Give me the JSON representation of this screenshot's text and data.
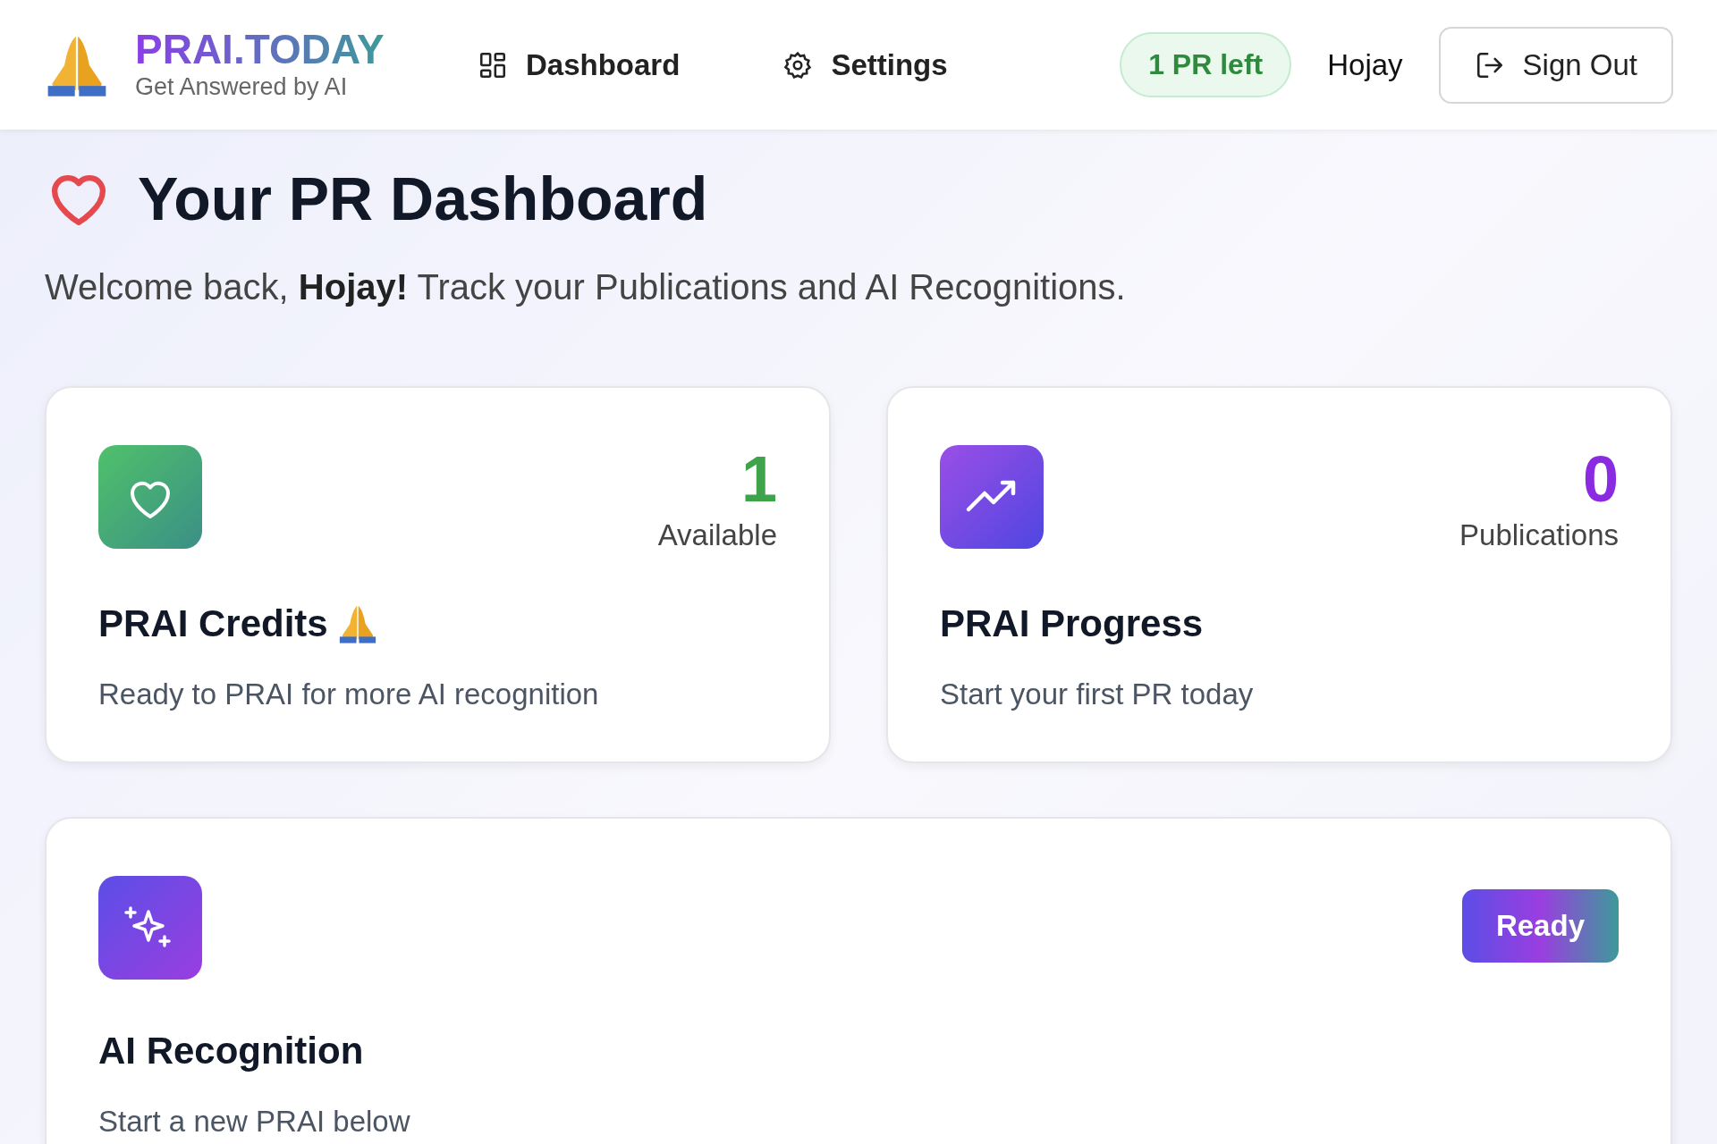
{
  "brand": {
    "name": "PRAI.TODAY",
    "tagline": "Get Answered by AI"
  },
  "nav": [
    {
      "label": "Dashboard",
      "kind": "grid"
    },
    {
      "label": "Settings",
      "kind": "gear"
    }
  ],
  "credits_badge": "1 PR left",
  "user": "Hojay",
  "sign_out": "Sign Out",
  "page_title": "Your PR Dashboard",
  "welcome": "Welcome back, **Hojay!** Track your Publications and AI Recognitions.",
  "stats": [
    {
      "kind": "credits",
      "value": "1",
      "caption": "Available",
      "title": "PRAI Credits",
      "description": "Ready to PRAI for more AI recognition",
      "color": "#3ea34a"
    },
    {
      "kind": "progress",
      "value": "0",
      "caption": "Publications",
      "title": "PRAI Progress",
      "description": "Start your first PR today",
      "color": "#8a2be2"
    }
  ],
  "recognition": {
    "title": "AI Recognition",
    "description": "Start a new PRAI below",
    "status": "Ready"
  }
}
